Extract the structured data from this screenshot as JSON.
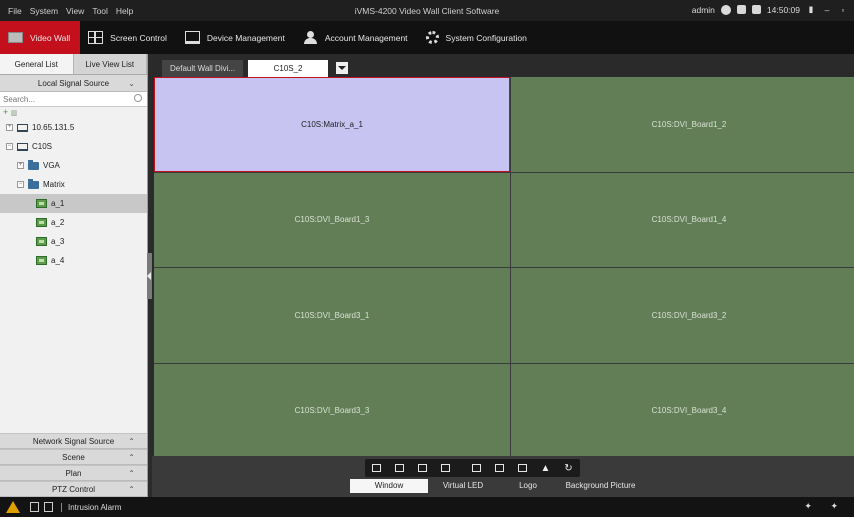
{
  "menu": [
    "File",
    "System",
    "View",
    "Tool",
    "Help"
  ],
  "app_title": "iVMS-4200 Video Wall Client Software",
  "window": {
    "user": "admin",
    "clock": "14:50:09"
  },
  "modules": [
    {
      "label": "Video Wall",
      "icon": "video-wall-icon",
      "active": true
    },
    {
      "label": "Screen Control",
      "icon": "screen-control-icon",
      "active": false
    },
    {
      "label": "Device Management",
      "icon": "device-management-icon",
      "active": false
    },
    {
      "label": "Account Management",
      "icon": "account-icon",
      "active": false
    },
    {
      "label": "System Configuration",
      "icon": "gear-icon",
      "active": false
    }
  ],
  "left_panel": {
    "tabs": [
      "General List",
      "Live View List"
    ],
    "local_source_label": "Local Signal Source",
    "search_placeholder": "Search...",
    "tree": [
      {
        "label": "10.65.131.5",
        "type": "device",
        "expander": "+",
        "depth": 0
      },
      {
        "label": "C10S",
        "type": "device",
        "expander": "−",
        "depth": 0
      },
      {
        "label": "VGA",
        "type": "folder",
        "expander": "+",
        "depth": 1
      },
      {
        "label": "Matrix",
        "type": "folder",
        "expander": "−",
        "depth": 1
      },
      {
        "label": "a_1",
        "type": "channel",
        "depth": 2,
        "selected": true
      },
      {
        "label": "a_2",
        "type": "channel",
        "depth": 2
      },
      {
        "label": "a_3",
        "type": "channel",
        "depth": 2
      },
      {
        "label": "a_4",
        "type": "channel",
        "depth": 2
      }
    ],
    "bottom_sections": [
      "Network Signal Source",
      "Scene",
      "Plan",
      "PTZ Control"
    ]
  },
  "wall": {
    "tabs": [
      "Default Wall Divi...",
      "C10S_2"
    ],
    "cells": [
      {
        "label": "C10S:Matrix_a_1",
        "selected": true
      },
      {
        "label": "C10S:DVI_Board1_2"
      },
      {
        "label": "C10S:DVI_Board1_3"
      },
      {
        "label": "C10S:DVI_Board1_4"
      },
      {
        "label": "C10S:DVI_Board3_1"
      },
      {
        "label": "C10S:DVI_Board3_2"
      },
      {
        "label": "C10S:DVI_Board3_3"
      },
      {
        "label": "C10S:DVI_Board3_4"
      }
    ]
  },
  "toolbar": {
    "labels": [
      "Window",
      "Virtual LED",
      "Logo",
      "Background Picture"
    ]
  },
  "status": {
    "alarm_label": "Intrusion Alarm"
  },
  "colors": {
    "accent": "#c4101c",
    "cell_bg": "#627e57",
    "selected_cell_bg": "#c8c4f1"
  }
}
